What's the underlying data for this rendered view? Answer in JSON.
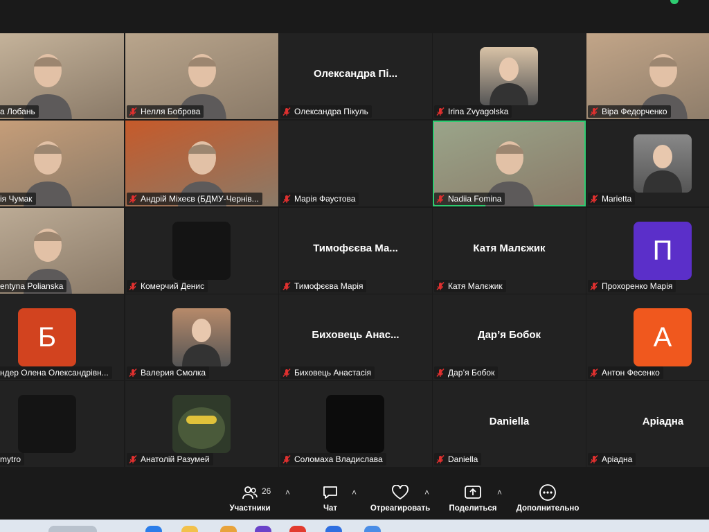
{
  "participants": [
    {
      "name": "Лобань",
      "display": "a Лобань",
      "kind": "video",
      "bg": "#c9b79e"
    },
    {
      "name": "Нелля Боброва",
      "kind": "video",
      "bg": "#b9a58c"
    },
    {
      "name": "Олександра Пікуль",
      "label": "Олександра Пі...",
      "kind": "name"
    },
    {
      "name": "Irina Zvyagolska",
      "kind": "thumbvideo",
      "bg": "#d8c2a6"
    },
    {
      "name": "Віра Федорченко",
      "kind": "video",
      "bg": "#c2a588"
    },
    {
      "name": "Чумак",
      "display": "ія Чумак",
      "kind": "video",
      "bg": "#caa07a"
    },
    {
      "name": "Андрій Міхеєв (БДМУ-Чернів...",
      "kind": "video",
      "bg": "#c65a2a"
    },
    {
      "name": "Марія Фаустова",
      "kind": "blank"
    },
    {
      "name": "Nadiia Fomina",
      "kind": "video",
      "bg": "#9aa58a",
      "active": true
    },
    {
      "name": "Marietta",
      "kind": "thumbvideo",
      "bg": "#888"
    },
    {
      "name": "Polianska",
      "display": "entyna Polianska",
      "kind": "video",
      "bg": "#bfae98"
    },
    {
      "name": "Комерчий Денис",
      "kind": "darkthumb"
    },
    {
      "name": "Тимофєєва Марія",
      "label": "Тимофєєва Ма...",
      "kind": "name"
    },
    {
      "name": "Катя Малєжик",
      "label": "Катя Малєжик",
      "kind": "name"
    },
    {
      "name": "Прохоренко Марія",
      "kind": "avatar",
      "letter": "П",
      "color": "#5b2fc9"
    },
    {
      "name": "Олена Олександрівна",
      "display": "ндер Олена Олександрівн...",
      "kind": "avatar",
      "letter": "Б",
      "color": "#d2431f"
    },
    {
      "name": "Валерия Смолка",
      "kind": "thumbphoto",
      "bg": "#b78a6a"
    },
    {
      "name": "Биховець Анастасія",
      "label": "Биховець Анас...",
      "kind": "name"
    },
    {
      "name": "Дар'я Бобок",
      "label": "Дар’я Бобок",
      "display": "Дар’я Бобок",
      "kind": "name"
    },
    {
      "name": "Антон Фесенко",
      "kind": "avatar",
      "letter": "А",
      "color": "#f0581e"
    },
    {
      "name": "mytro",
      "display": "mytro",
      "kind": "darkthumb"
    },
    {
      "name": "Анатолій Разумей",
      "kind": "thumbgame"
    },
    {
      "name": "Соломаха Владислава",
      "kind": "darkthumb2"
    },
    {
      "name": "Daniella",
      "label": "Daniella",
      "kind": "name"
    },
    {
      "name": "Аріадна",
      "label": "Аріадна",
      "kind": "name"
    }
  ],
  "toolbar": {
    "participants_label": "Участники",
    "participants_count": "26",
    "chat_label": "Чат",
    "react_label": "Отреагировать",
    "share_label": "Поделиться",
    "more_label": "Дополнительно"
  },
  "colors": {
    "active_border": "#2ecc71",
    "muted_mic": "#e0302f",
    "background": "#1a1a1a"
  }
}
